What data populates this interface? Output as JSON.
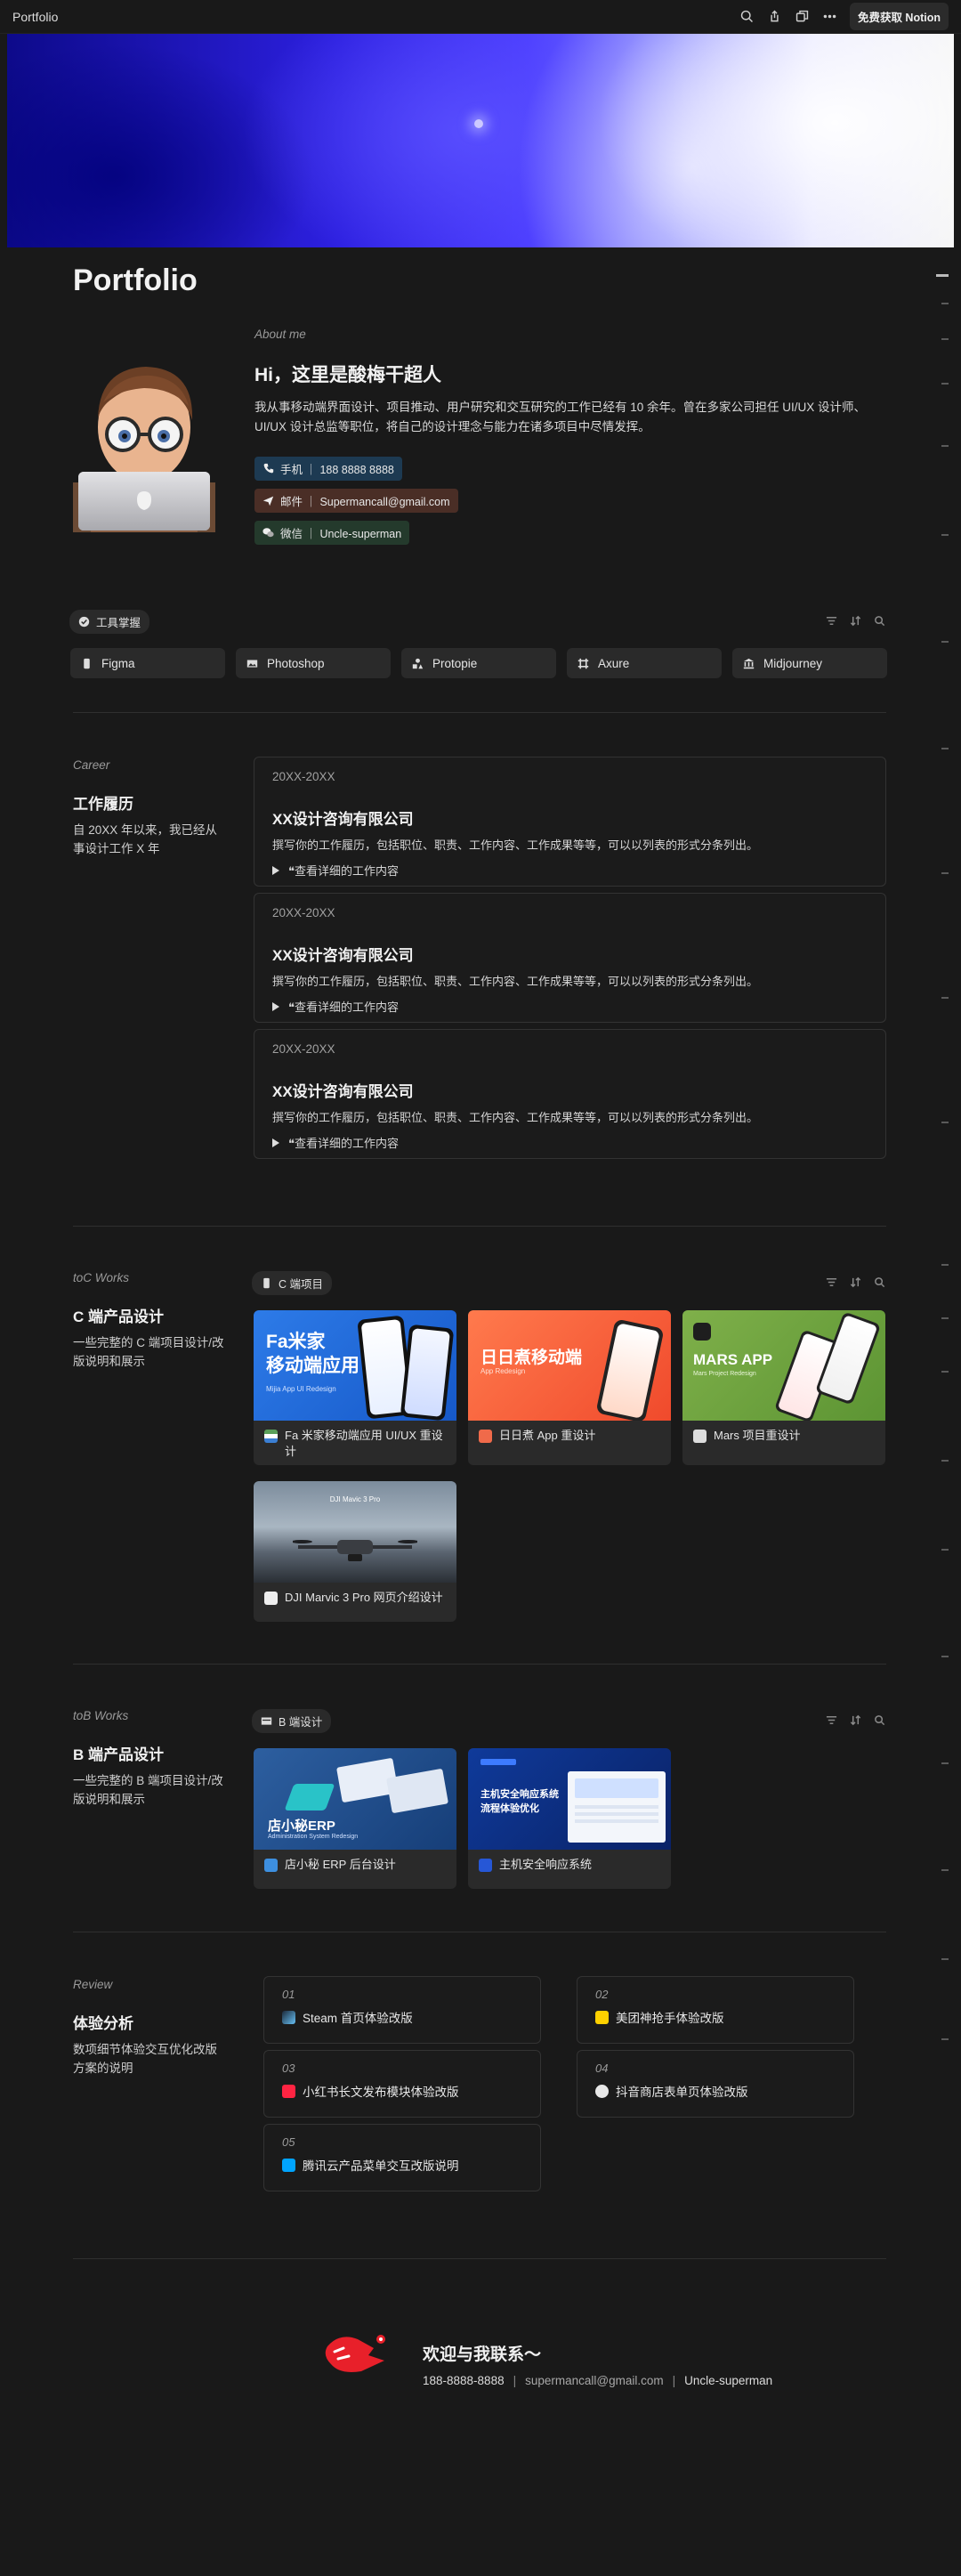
{
  "topbar": {
    "title": "Portfolio",
    "get_notion": "免费获取 Notion"
  },
  "page": {
    "title": "Portfolio"
  },
  "about": {
    "label": "About me",
    "greeting": "Hi，这里是酸梅干超人",
    "bio": "我从事移动端界面设计、项目推动、用户研究和交互研究的工作已经有 10 余年。曾在多家公司担任 UI/UX 设计师、UI/UX 设计总监等职位，将自己的设计理念与能力在诸多项目中尽情发挥。",
    "contacts": [
      {
        "label": "手机 ｜ 188 8888 8888",
        "color": "#1d3a52",
        "icon": "phone-icon"
      },
      {
        "label": "邮件 ｜ Supermancall@gmail.com",
        "color": "#4a2e26",
        "icon": "send-icon"
      },
      {
        "label": "微信 ｜ Uncle-superman",
        "color": "#243a2c",
        "icon": "wechat-icon"
      }
    ]
  },
  "tools": {
    "pill": "工具掌握",
    "items": [
      {
        "label": "Figma",
        "icon": "figma-icon"
      },
      {
        "label": "Photoshop",
        "icon": "image-icon"
      },
      {
        "label": "Protopie",
        "icon": "shapes-icon"
      },
      {
        "label": "Axure",
        "icon": "frame-icon"
      },
      {
        "label": "Midjourney",
        "icon": "bank-icon"
      }
    ]
  },
  "career": {
    "label": "Career",
    "title": "工作履历",
    "desc": "自 20XX 年以来，我已经从事设计工作 X 年",
    "jobs": [
      {
        "years": "20XX-20XX",
        "company": "XX设计咨询有限公司",
        "desc": "撰写你的工作履历，包括职位、职责、工作内容、工作成果等等，可以以列表的形式分条列出。",
        "toggle": "❝查看详细的工作内容"
      },
      {
        "years": "20XX-20XX",
        "company": "XX设计咨询有限公司",
        "desc": "撰写你的工作履历，包括职位、职责、工作内容、工作成果等等，可以以列表的形式分条列出。",
        "toggle": "❝查看详细的工作内容"
      },
      {
        "years": "20XX-20XX",
        "company": "XX设计咨询有限公司",
        "desc": "撰写你的工作履历，包括职位、职责、工作内容、工作成果等等，可以以列表的形式分条列出。",
        "toggle": "❝查看详细的工作内容"
      }
    ]
  },
  "toc": {
    "label": "toC Works",
    "title": "C 端产品设计",
    "desc": "一些完整的 C 端项目设计/改版说明和展示",
    "pill": "C 端项目",
    "cards": [
      {
        "caption": "Fa 米家移动端应用 UI/UX 重设计",
        "img_text": "Fa米家\n移动端应用",
        "img_sub": "Mijia App UI Redesign"
      },
      {
        "caption": "日日煮 App 重设计",
        "img_text": "日日煮移动端",
        "img_sub": "App Redesign"
      },
      {
        "caption": "Mars 项目重设计",
        "img_text": "MARS APP",
        "img_sub": "Mars Project Redesign"
      },
      {
        "caption": "DJI Marvic 3 Pro 网页介绍设计",
        "img_text": "DJI Mavic 3 Pro",
        "img_sub": ""
      }
    ]
  },
  "tob": {
    "label": "toB Works",
    "title": "B 端产品设计",
    "desc": "一些完整的 B 端项目设计/改版说明和展示",
    "pill": "B 端设计",
    "cards": [
      {
        "caption": "店小秘 ERP 后台设计",
        "img_text": "店小秘ERP",
        "img_sub": "Administration System Redesign"
      },
      {
        "caption": "主机安全响应系统",
        "img_text": "主机安全响应系统\n流程体验优化",
        "img_sub": ""
      }
    ]
  },
  "review": {
    "label": "Review",
    "title": "体验分析",
    "desc": "数项细节体验交互优化改版方案的说明",
    "items": [
      {
        "num": "01",
        "title": "Steam 首页体验改版"
      },
      {
        "num": "02",
        "title": "美团神抢手体验改版"
      },
      {
        "num": "03",
        "title": "小红书长文发布模块体验改版"
      },
      {
        "num": "04",
        "title": "抖音商店表单页体验改版"
      },
      {
        "num": "05",
        "title": "腾讯云产品菜单交互改版说明"
      }
    ]
  },
  "footer": {
    "title": "欢迎与我联系～",
    "phone": "188-8888-8888",
    "email": "supermancall@gmail.com",
    "wechat": "Uncle-superman",
    "sep": "|"
  }
}
